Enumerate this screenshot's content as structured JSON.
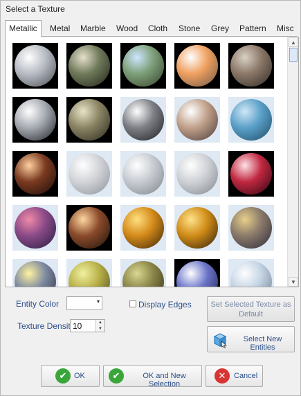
{
  "dialog": {
    "title": "Select a Texture"
  },
  "tabs": [
    {
      "label": "Metallic",
      "active": true
    },
    {
      "label": "Metal"
    },
    {
      "label": "Marble"
    },
    {
      "label": "Wood"
    },
    {
      "label": "Cloth"
    },
    {
      "label": "Stone"
    },
    {
      "label": "Grey"
    },
    {
      "label": "Pattern"
    },
    {
      "label": "Misc"
    }
  ],
  "textures": [
    {
      "name": "chrome-silver-sphere",
      "bg": "dark",
      "colors": [
        "#ffffff",
        "#b8bcc4",
        "#4a4c52"
      ]
    },
    {
      "name": "room-reflection-sphere",
      "bg": "dark",
      "colors": [
        "#e6e0cc",
        "#6f7a5a",
        "#222418"
      ]
    },
    {
      "name": "sky-landscape-sphere",
      "bg": "dark",
      "colors": [
        "#cfe6ff",
        "#7d9f78",
        "#35402a"
      ]
    },
    {
      "name": "studio-orange-sphere",
      "bg": "dark",
      "colors": [
        "#ffffff",
        "#f0a060",
        "#6a5848"
      ]
    },
    {
      "name": "dark-room-sphere",
      "bg": "dark",
      "colors": [
        "#d8d0c4",
        "#8c7868",
        "#2e2a26"
      ]
    },
    {
      "name": "mirror-chrome-sphere",
      "bg": "dark",
      "colors": [
        "#ffffff",
        "#a6aab2",
        "#1e2024"
      ]
    },
    {
      "name": "warm-room-sphere",
      "bg": "dark",
      "colors": [
        "#e8e2c8",
        "#8a8464",
        "#2a281e"
      ]
    },
    {
      "name": "satin-silver-sphere",
      "bg": "light",
      "colors": [
        "#ffffff",
        "#7e8086",
        "#1c1c20"
      ]
    },
    {
      "name": "brushed-bronze-sphere",
      "bg": "light",
      "colors": [
        "#ffffff",
        "#c0a08a",
        "#4a3a38"
      ]
    },
    {
      "name": "blue-steel-sphere",
      "bg": "light",
      "colors": [
        "#d0e6f6",
        "#5aa0c8",
        "#1e4a66"
      ]
    },
    {
      "name": "copper-lights-sphere",
      "bg": "dark",
      "colors": [
        "#ffd0a0",
        "#7a3a20",
        "#1a0c08"
      ]
    },
    {
      "name": "frosted-silver-sphere",
      "bg": "light",
      "colors": [
        "#ffffff",
        "#d2d4d8",
        "#8c9096"
      ]
    },
    {
      "name": "polished-silver-sphere",
      "bg": "light",
      "colors": [
        "#ffffff",
        "#c8ccd2",
        "#7c8088"
      ]
    },
    {
      "name": "pearl-silver-sphere",
      "bg": "light",
      "colors": [
        "#ffffff",
        "#cfd2d6",
        "#80858c"
      ]
    },
    {
      "name": "red-horizon-sphere",
      "bg": "dark",
      "colors": [
        "#ffe2e6",
        "#c02840",
        "#2a0610"
      ]
    },
    {
      "name": "purple-pink-sphere",
      "bg": "light",
      "colors": [
        "#f08aa8",
        "#8a4a88",
        "#241c3e"
      ]
    },
    {
      "name": "city-night-sphere",
      "bg": "dark",
      "colors": [
        "#ffd6a0",
        "#8a4a2a",
        "#1c120c"
      ]
    },
    {
      "name": "golden-sunset-sphere",
      "bg": "light",
      "colors": [
        "#ffe080",
        "#d48a1a",
        "#3a2408"
      ]
    },
    {
      "name": "gold-skyline-sphere",
      "bg": "light",
      "colors": [
        "#ffe28a",
        "#d08c18",
        "#2e1e08"
      ]
    },
    {
      "name": "blurred-gold-sphere",
      "bg": "light",
      "colors": [
        "#e8d08a",
        "#8a7a6a",
        "#2a2a3a"
      ]
    },
    {
      "name": "dusk-skyline-sphere",
      "bg": "light",
      "colors": [
        "#fff2a0",
        "#7e8aa0",
        "#2a2a3e"
      ]
    },
    {
      "name": "olive-gold-sphere",
      "bg": "light",
      "colors": [
        "#f0f0a0",
        "#b8b048",
        "#4a461a"
      ]
    },
    {
      "name": "olive-dark-sphere",
      "bg": "light",
      "colors": [
        "#d8d890",
        "#8a8448",
        "#2e2c18"
      ]
    },
    {
      "name": "night-glow-sphere",
      "bg": "dark",
      "colors": [
        "#ffffff",
        "#6a74c8",
        "#1a1e48"
      ]
    },
    {
      "name": "pale-sky-sphere",
      "bg": "light",
      "colors": [
        "#ffffff",
        "#c4d4e4",
        "#6a7a8e"
      ]
    }
  ],
  "scrollbar": {
    "up_glyph": "▲",
    "down_glyph": "▼"
  },
  "entity_color": {
    "label": "Entity Color",
    "value": "",
    "arrow_glyph": "▾"
  },
  "display_edges": {
    "label": "Display Edges",
    "checked": false
  },
  "texture_density": {
    "label": "Texture Density",
    "value": "10",
    "up_glyph": "▲",
    "down_glyph": "▼"
  },
  "buttons": {
    "set_default": "Set Selected Texture as Default",
    "select_entities": "Select New Entities",
    "ok": "OK",
    "ok_new_selection": "OK and New Selection",
    "cancel": "Cancel"
  },
  "icons": {
    "ok": {
      "name": "check-icon",
      "glyph": "✔",
      "color": "#3aa63a"
    },
    "ok_new": {
      "name": "check-icon",
      "glyph": "✔",
      "color": "#3aa63a"
    },
    "cancel": {
      "name": "close-icon",
      "glyph": "✕",
      "color": "#d83434"
    },
    "select_entities": {
      "name": "cube-select-icon",
      "color": "#2e7fbf"
    }
  }
}
